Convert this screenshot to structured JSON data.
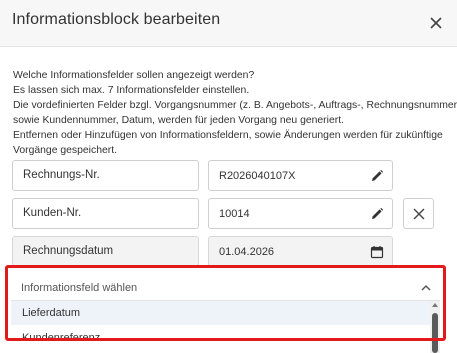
{
  "dialog": {
    "title": "Informationsblock bearbeiten",
    "description": [
      "Welche Informationsfelder sollen angezeigt werden?",
      "Es lassen sich max. 7 Informationsfelder einstellen.",
      "Die vordefinierten Felder bzgl. Vorgangsnummer (z. B. Angebots-, Auftrags-, Rechnungsnummer),",
      "sowie Kundennummer, Datum, werden für jeden Vorgang neu generiert.",
      "Entfernen oder Hinzufügen von Informationsfeldern, sowie Änderungen werden für zukünftige",
      "Vorgänge gespeichert."
    ]
  },
  "fields": [
    {
      "label": "Rechnungs-Nr.",
      "value": "R2026040107X",
      "icon": "pencil-icon"
    },
    {
      "label": "Kunden-Nr.",
      "value": "10014",
      "icon": "pencil-icon"
    },
    {
      "label": "Rechnungsdatum",
      "value": "01.04.2026",
      "icon": "calendar-icon"
    }
  ],
  "select": {
    "placeholder": "Informationsfeld wählen",
    "options": [
      "Lieferdatum",
      "Kundenreferenz"
    ],
    "highlighted": "Lieferdatum"
  },
  "colors": {
    "highlight_border": "#e21a1a",
    "highlight_row": "#eef3fa"
  }
}
